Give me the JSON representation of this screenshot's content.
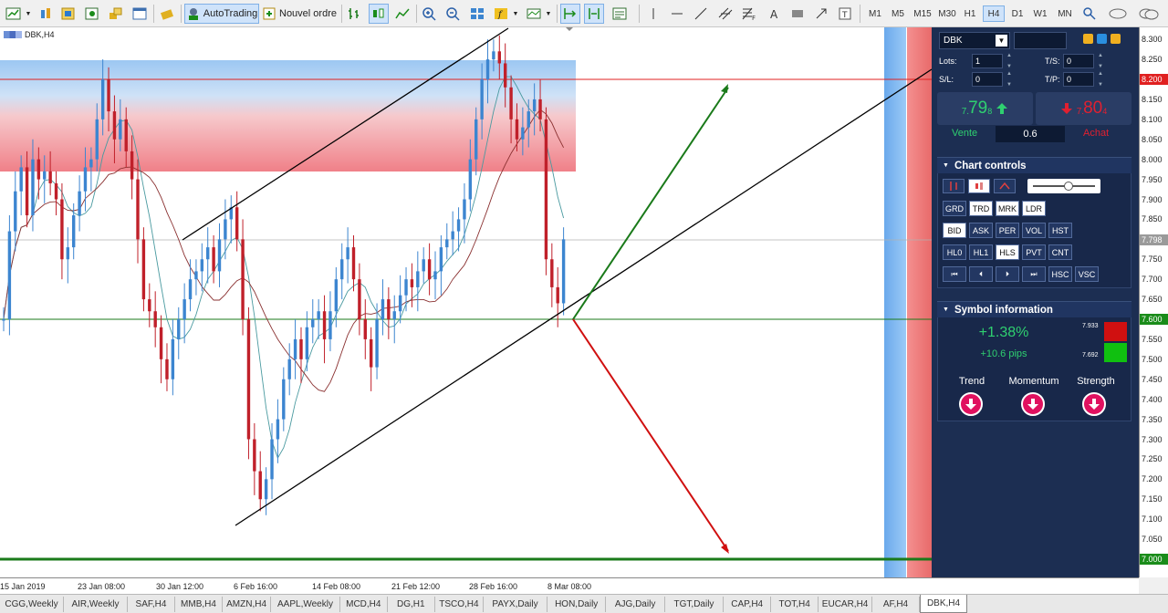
{
  "toolbar": {
    "autotrading_label": "AutoTrading",
    "new_order_label": "Nouvel ordre",
    "timeframes": [
      "M1",
      "M5",
      "M15",
      "M30",
      "H1",
      "H4",
      "D1",
      "W1",
      "MN"
    ],
    "active_timeframe": "H4"
  },
  "chart": {
    "title": "DBK,H4",
    "price_ticks": [
      "8.300",
      "8.250",
      "8.200",
      "8.150",
      "8.100",
      "8.050",
      "8.000",
      "7.950",
      "7.900",
      "7.850",
      "7.800",
      "7.750",
      "7.700",
      "7.650",
      "7.600",
      "7.550",
      "7.500",
      "7.450",
      "7.400",
      "7.350",
      "7.300",
      "7.250",
      "7.200",
      "7.150",
      "7.100",
      "7.050",
      "7.000"
    ],
    "badges": [
      {
        "value": "8.200",
        "color": "#e02020"
      },
      {
        "value": "7.798",
        "color": "#9a9a9a"
      },
      {
        "value": "7.600",
        "color": "#1a8c1a"
      },
      {
        "value": "7.000",
        "color": "#1a8c1a"
      }
    ],
    "time_labels": [
      "15 Jan 2019",
      "23 Jan 08:00",
      "30 Jan 12:00",
      "6 Feb 16:00",
      "14 Feb 08:00",
      "21 Feb 12:00",
      "28 Feb 16:00",
      "8 Mar 08:00"
    ],
    "colors": {
      "bull": "#3c85d0",
      "bear": "#c0202a",
      "support": "#1a7a1a",
      "resistance": "#e02020"
    }
  },
  "panel": {
    "symbol": "DBK",
    "lots_label": "Lots:",
    "lots_value": "1",
    "sl_label": "S/L:",
    "sl_value": "0",
    "ts_label": "T/S:",
    "ts_value": "0",
    "tp_label": "T/P:",
    "tp_value": "0",
    "sell": {
      "prefix": "7.",
      "big": "79",
      "small": "8",
      "label": "Vente"
    },
    "buy": {
      "prefix": "7.",
      "big": "80",
      "small": "4",
      "label": "Achat"
    },
    "spread": "0.6",
    "chart_controls": {
      "title": "Chart controls",
      "row1": [
        "GRD",
        "TRD",
        "MRK",
        "LDR"
      ],
      "row2": [
        "BID",
        "ASK",
        "PER",
        "VOL",
        "HST"
      ],
      "row3": [
        "HL0",
        "HL1",
        "HLS",
        "PVT",
        "CNT"
      ],
      "row4": [
        "⏮",
        "⏴",
        "⏵",
        "⏭",
        "HSC",
        "VSC"
      ]
    },
    "symbol_info": {
      "title": "Symbol information",
      "change_pct": "+1.38%",
      "change_pips": "+10.6 pips",
      "high": "7.933",
      "low": "7.692",
      "indicators": [
        "Trend",
        "Momentum",
        "Strength"
      ]
    }
  },
  "tabs": [
    "CGG,Weekly",
    "AIR,Weekly",
    "SAF,H4",
    "MMB,H4",
    "AMZN,H4",
    "AAPL,Weekly",
    "MCD,H4",
    "DG,H1",
    "TSCO,H4",
    "PAYX,Daily",
    "HON,Daily",
    "AJG,Daily",
    "TGT,Daily",
    "CAP,H4",
    "TOT,H4",
    "EUCAR,H4",
    "AF,H4",
    "DBK,H4"
  ],
  "active_tab": "DBK,H4"
}
